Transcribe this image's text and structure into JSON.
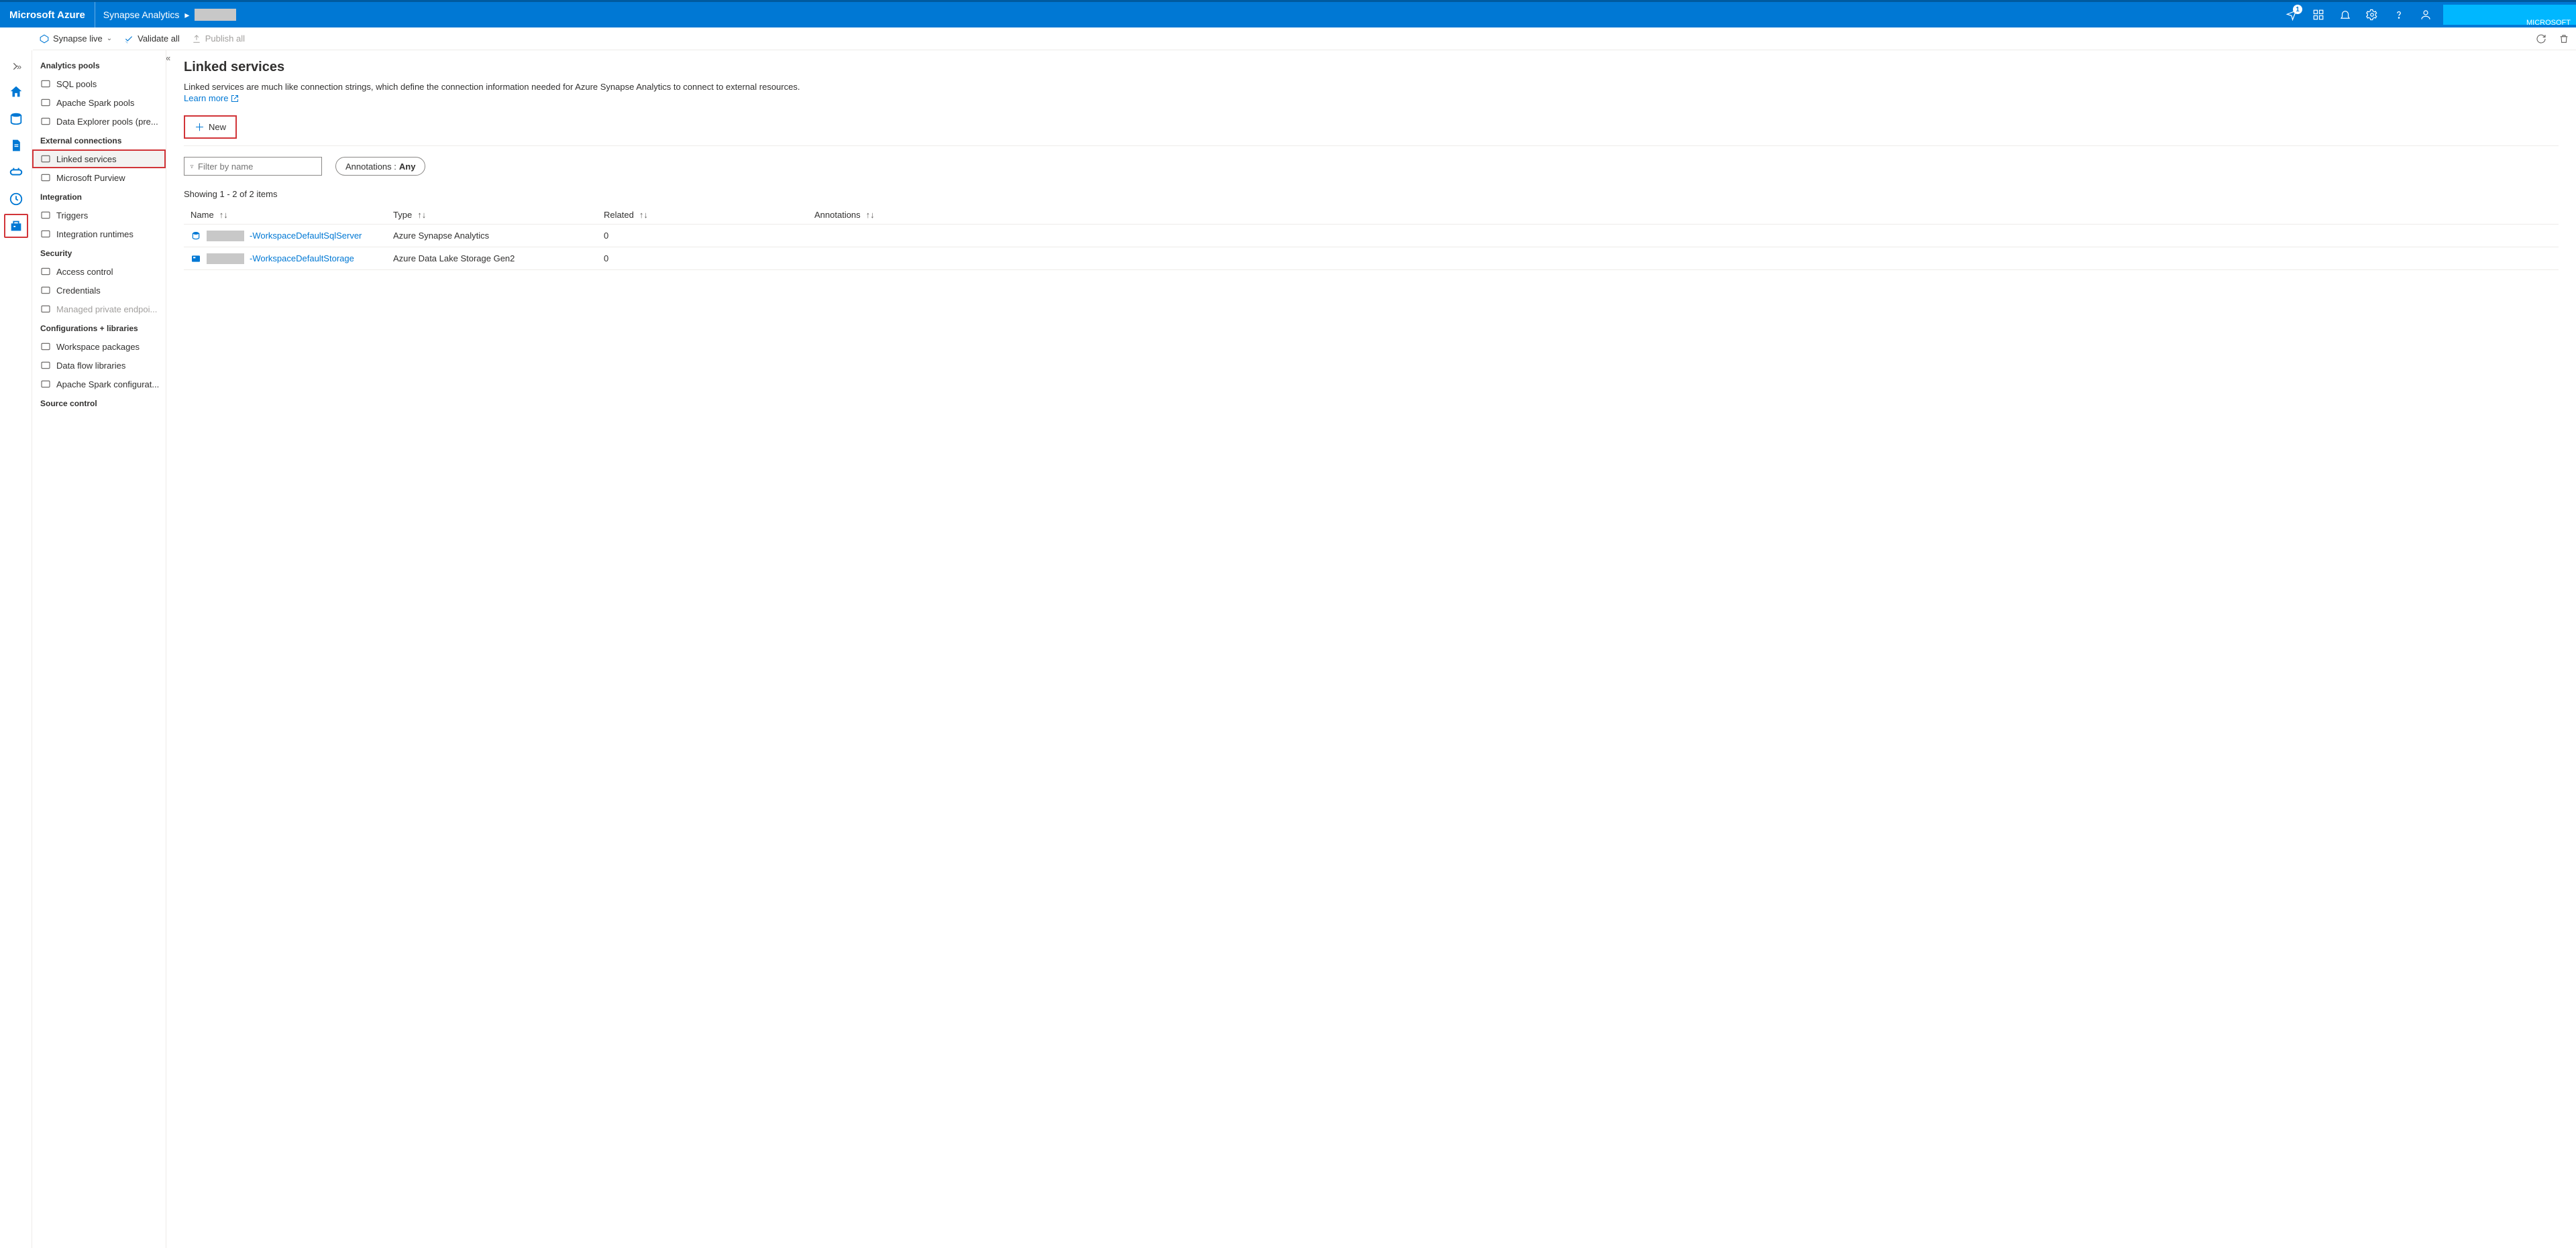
{
  "topbar": {
    "brand": "Microsoft Azure",
    "service": "Synapse Analytics",
    "tenant": "MICROSOFT",
    "notification_count": "1"
  },
  "cmdbar": {
    "mode": "Synapse live",
    "validate": "Validate all",
    "publish": "Publish all"
  },
  "tree": {
    "sections": [
      {
        "header": "Analytics pools",
        "items": [
          {
            "label": "SQL pools"
          },
          {
            "label": "Apache Spark pools"
          },
          {
            "label": "Data Explorer pools (pre..."
          }
        ]
      },
      {
        "header": "External connections",
        "items": [
          {
            "label": "Linked services",
            "selected": true
          },
          {
            "label": "Microsoft Purview"
          }
        ]
      },
      {
        "header": "Integration",
        "items": [
          {
            "label": "Triggers"
          },
          {
            "label": "Integration runtimes"
          }
        ]
      },
      {
        "header": "Security",
        "items": [
          {
            "label": "Access control"
          },
          {
            "label": "Credentials"
          },
          {
            "label": "Managed private endpoi...",
            "disabled": true
          }
        ]
      },
      {
        "header": "Configurations + libraries",
        "items": [
          {
            "label": "Workspace packages"
          },
          {
            "label": "Data flow libraries"
          },
          {
            "label": "Apache Spark configurat..."
          }
        ]
      },
      {
        "header": "Source control",
        "items": []
      }
    ]
  },
  "main": {
    "title": "Linked services",
    "description": "Linked services are much like connection strings, which define the connection information needed for Azure Synapse Analytics to connect to external resources.",
    "learn_more": "Learn more",
    "new_label": "New",
    "filter_placeholder": "Filter by name",
    "annotations_label": "Annotations :",
    "annotations_value": "Any",
    "count_text": "Showing 1 - 2 of 2 items",
    "columns": {
      "name": "Name",
      "type": "Type",
      "related": "Related",
      "annotations": "Annotations"
    },
    "rows": [
      {
        "name_suffix": "-WorkspaceDefaultSqlServer",
        "type": "Azure Synapse Analytics",
        "related": "0"
      },
      {
        "name_suffix": "-WorkspaceDefaultStorage",
        "type": "Azure Data Lake Storage Gen2",
        "related": "0"
      }
    ]
  }
}
